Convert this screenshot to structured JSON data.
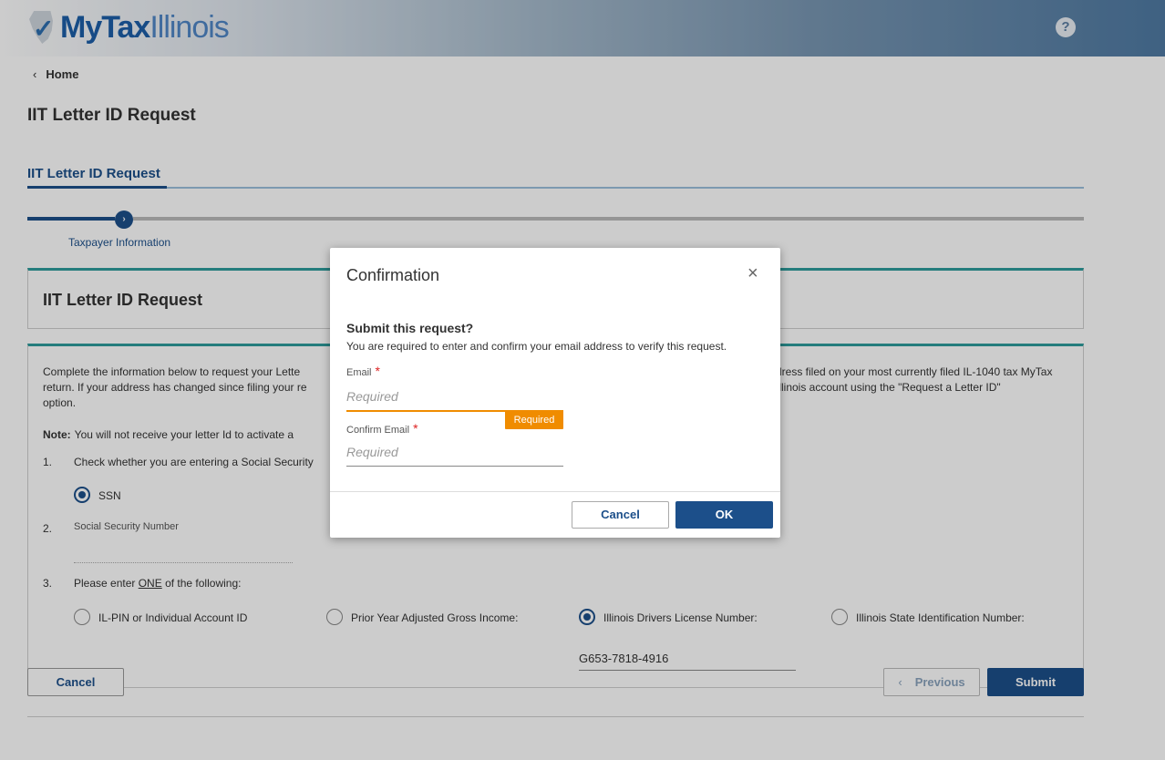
{
  "header": {
    "logo_my": "My",
    "logo_tax": "Tax",
    "logo_illinois": "Illinois",
    "help_label": "?"
  },
  "nav": {
    "home_label": "Home"
  },
  "page": {
    "title": "IIT Letter ID Request",
    "section_tab": "IIT Letter ID Request",
    "step_label": "Taxpayer Information",
    "card_title": "IIT Letter ID Request"
  },
  "form": {
    "intro_left": "Complete the information below to request your Lette return. If your address has changed since filing your re option.",
    "intro_right": "dress filed on your most currently filed IL-1040 tax MyTax Illinois account using the \"Request a Letter ID\"",
    "note_label": "Note:",
    "note_text": "You will not receive your letter Id to activate a",
    "q1_num": "1.",
    "q1_text": "Check whether you are entering a Social Security",
    "ssn_label": "SSN",
    "q2_num": "2.",
    "q2_text": "Social Security Number",
    "q3_num": "3.",
    "q3_text_before": "Please enter ",
    "q3_text_one": "ONE",
    "q3_text_after": " of the following:",
    "options": [
      {
        "label": "IL-PIN or Individual Account ID",
        "selected": false
      },
      {
        "label": "Prior Year Adjusted Gross Income:",
        "selected": false
      },
      {
        "label": "Illinois Drivers License Number:",
        "selected": true
      },
      {
        "label": "Illinois State Identification Number:",
        "selected": false
      }
    ],
    "dl_value": "G653-7818-4916"
  },
  "footer": {
    "cancel_label": "Cancel",
    "previous_label": "Previous",
    "submit_label": "Submit"
  },
  "modal": {
    "title": "Confirmation",
    "close_glyph": "×",
    "sub_title": "Submit this request?",
    "sub_text": "You are required to enter and confirm your email address to verify this request.",
    "email_label": "Email",
    "email_placeholder": "Required",
    "email_error": "Required",
    "confirm_label": "Confirm Email",
    "confirm_placeholder": "Required",
    "required_marker": "*",
    "cancel_label": "Cancel",
    "ok_label": "OK"
  },
  "colors": {
    "primary": "#1c4f8a",
    "accent_teal": "#2e9c9c",
    "warning_orange": "#f08c00",
    "required_red": "#d22222"
  }
}
